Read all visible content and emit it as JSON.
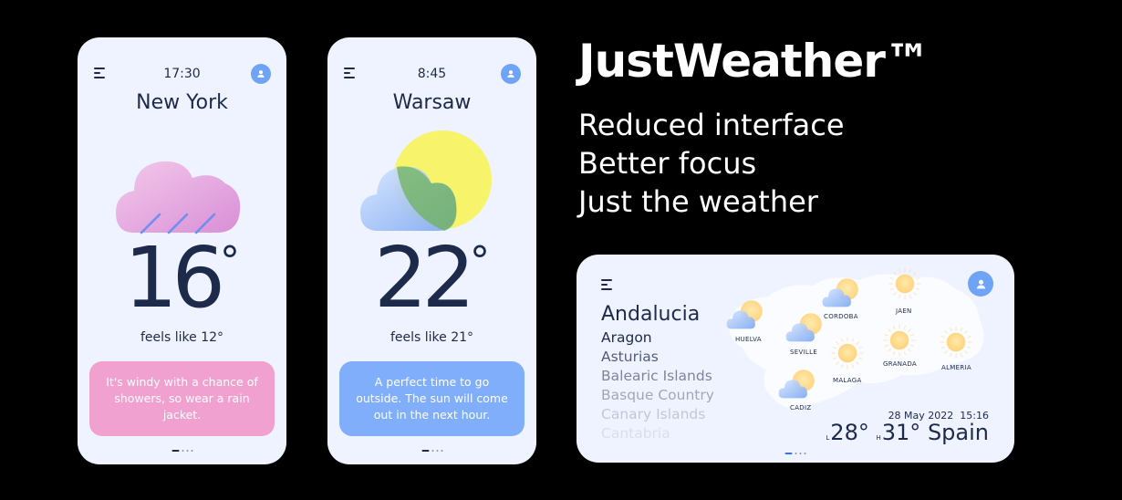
{
  "phones": [
    {
      "time": "17:30",
      "city": "New York",
      "temp": "16",
      "deg": "°",
      "feels": "feels like 12°",
      "message": "It's windy with a chance of showers, so wear a rain jacket."
    },
    {
      "time": "8:45",
      "city": "Warsaw",
      "temp": "22",
      "deg": "°",
      "feels": "feels like 21°",
      "message": "A perfect time to go outside. The sun will come out in the next hour."
    }
  ],
  "brand": "JustWeather™",
  "taglines": [
    "Reduced interface",
    "Better focus",
    "Just the weather"
  ],
  "card": {
    "region_selected": "Andalucia",
    "regions": [
      "Aragon",
      "Asturias",
      "Balearic Islands",
      "Basque Country",
      "Canary Islands",
      "Cantabria"
    ],
    "cities": {
      "huelva": "HUELVA",
      "seville": "SEVILLE",
      "cordoba": "CORDOBA",
      "jaen": "JAEN",
      "granada": "GRANADA",
      "almeria": "ALMERIA",
      "malaga": "MALAGA",
      "cadiz": "CADIZ"
    },
    "date": "28 May 2022",
    "clock": "15:16",
    "low_marker": "L",
    "low_temp": "28°",
    "high_marker": "H",
    "high_temp": "31°",
    "country": "Spain"
  },
  "icons": {
    "menu": "menu-icon",
    "user": "user-icon",
    "rain_cloud": "rain-cloud-icon",
    "sun_cloud": "sun-cloud-icon",
    "sun": "sun-icon"
  },
  "colors": {
    "background": "#000000",
    "panel": "#eef3ff",
    "text": "#1e2a4a",
    "accent_blue": "#6fa3f5",
    "pink_message": "#f0a1cf",
    "blue_message": "#80aefa",
    "sun_yellow": "#f7f36b"
  }
}
